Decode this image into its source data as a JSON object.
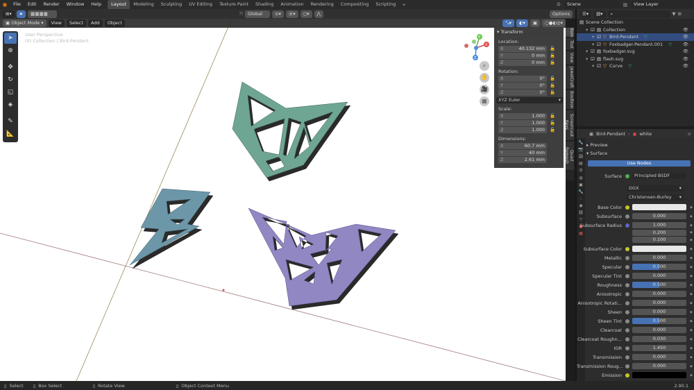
{
  "menu": [
    "File",
    "Edit",
    "Render",
    "Window",
    "Help"
  ],
  "workspaces": [
    "Layout",
    "Modeling",
    "Sculpting",
    "UV Editing",
    "Texture Paint",
    "Shading",
    "Animation",
    "Rendering",
    "Compositing",
    "Scripting"
  ],
  "active_workspace": "Layout",
  "add_tab": "+",
  "scene": {
    "label": "Scene"
  },
  "view_layer": {
    "label": "View Layer"
  },
  "header": {
    "transform_orientation": "Global",
    "options": "Options"
  },
  "viewport": {
    "mode": "Object Mode",
    "menus": [
      "View",
      "Select",
      "Add",
      "Object"
    ],
    "overlay_line1": "User Perspective",
    "overlay_line2": "(0) Collection | Bird-Pendant",
    "gizmo_axes": [
      "X",
      "Y",
      "Z"
    ]
  },
  "npanel": {
    "title": "Transform",
    "location_label": "Location:",
    "location": [
      {
        "axis": "X",
        "value": "40.132 mm"
      },
      {
        "axis": "Y",
        "value": "0 mm"
      },
      {
        "axis": "Z",
        "value": "0 mm"
      }
    ],
    "rotation_label": "Rotation:",
    "rotation": [
      {
        "axis": "X",
        "value": "0°"
      },
      {
        "axis": "Y",
        "value": "0°"
      },
      {
        "axis": "Z",
        "value": "0°"
      }
    ],
    "rotation_mode": "XYZ Euler",
    "scale_label": "Scale:",
    "scale": [
      {
        "axis": "X",
        "value": "1.000"
      },
      {
        "axis": "Y",
        "value": "1.000"
      },
      {
        "axis": "Z",
        "value": "1.000"
      }
    ],
    "dimensions_label": "Dimensions:",
    "dimensions": [
      {
        "axis": "X",
        "value": "60.7 mm"
      },
      {
        "axis": "Y",
        "value": "40 mm"
      },
      {
        "axis": "Z",
        "value": "2.61 mm"
      }
    ]
  },
  "side_tabs": [
    "Item",
    "Tool",
    "View",
    "JewelCraft",
    "Booltron",
    "Screencast Keys",
    "Quad Remesh"
  ],
  "outliner": {
    "rows": [
      {
        "text": "Scene Collection",
        "indent": 0,
        "selected": false,
        "tag": ""
      },
      {
        "text": "Collection",
        "indent": 1,
        "selected": false,
        "tag": ""
      },
      {
        "text": "Bird-Pendant",
        "indent": 2,
        "selected": true,
        "tag": "▽"
      },
      {
        "text": "Foxbadger-Pendant.001",
        "indent": 2,
        "selected": false,
        "tag": "▽"
      },
      {
        "text": "foxbadger.svg",
        "indent": 1,
        "selected": false,
        "tag": ""
      },
      {
        "text": "flash.svg",
        "indent": 1,
        "selected": false,
        "tag": ""
      },
      {
        "text": "Curve",
        "indent": 2,
        "selected": false,
        "tag": "▽"
      }
    ]
  },
  "properties": {
    "object": "Bird-Pendant",
    "material": "white",
    "sections": [
      "Preview",
      "Surface"
    ],
    "use_nodes": "Use Nodes",
    "surface_label": "Surface",
    "surface_value": "Principled BSDF",
    "distribution": "GGX",
    "subsurface_method": "Christensen-Burley",
    "rows": [
      {
        "label": "Base Color",
        "value": "",
        "dot": "y",
        "kind": "white"
      },
      {
        "label": "Subsurface",
        "value": "0.000",
        "dot": "g",
        "kind": "plain"
      },
      {
        "label": "Subsurface Radius",
        "value": "1.000",
        "dot": "p",
        "kind": "plain"
      },
      {
        "label": "",
        "value": "0.200",
        "dot": "",
        "kind": "plain"
      },
      {
        "label": "",
        "value": "0.100",
        "dot": "",
        "kind": "plain"
      },
      {
        "label": "Subsurface Color",
        "value": "",
        "dot": "y",
        "kind": "white"
      },
      {
        "label": "Metallic",
        "value": "0.000",
        "dot": "g",
        "kind": "plain"
      },
      {
        "label": "Specular",
        "value": "0.500",
        "dot": "g",
        "kind": "fill"
      },
      {
        "label": "Specular Tint",
        "value": "0.000",
        "dot": "g",
        "kind": "plain"
      },
      {
        "label": "Roughness",
        "value": "0.500",
        "dot": "g",
        "kind": "fill"
      },
      {
        "label": "Anisotropic",
        "value": "0.000",
        "dot": "g",
        "kind": "plain"
      },
      {
        "label": "Anisotropic Rotati...",
        "value": "0.000",
        "dot": "g",
        "kind": "plain"
      },
      {
        "label": "Sheen",
        "value": "0.000",
        "dot": "g",
        "kind": "plain"
      },
      {
        "label": "Sheen Tint",
        "value": "0.500",
        "dot": "g",
        "kind": "fill"
      },
      {
        "label": "Clearcoat",
        "value": "0.000",
        "dot": "g",
        "kind": "plain"
      },
      {
        "label": "Clearcoat Roughn...",
        "value": "0.030",
        "dot": "g",
        "kind": "plain"
      },
      {
        "label": "IOR",
        "value": "1.450",
        "dot": "g",
        "kind": "plain"
      },
      {
        "label": "Transmission",
        "value": "0.000",
        "dot": "g",
        "kind": "plain"
      },
      {
        "label": "Transmission Roug...",
        "value": "0.000",
        "dot": "g",
        "kind": "plain"
      },
      {
        "label": "Emission",
        "value": "",
        "dot": "y",
        "kind": "black"
      }
    ]
  },
  "status": {
    "select": "Select",
    "box_select": "Box Select",
    "rotate": "Rotate View",
    "context": "Object Context Menu",
    "version": "2.90.1"
  },
  "colors": {
    "fox": "#6ea693",
    "bird": "#9187c3",
    "flash": "#6c97a8",
    "accent": "#4772b3",
    "selected_row": "#334d80"
  }
}
